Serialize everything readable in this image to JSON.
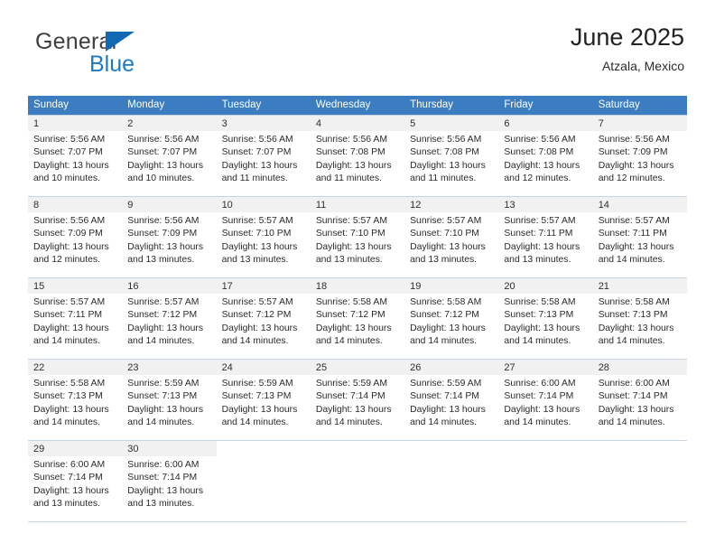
{
  "brand": {
    "name_top": "General",
    "name_bottom": "Blue",
    "triangle_icon": "blue-triangle-logo-icon",
    "color_top": "#3f3f3f",
    "color_bottom": "#1b7ac4"
  },
  "header": {
    "title": "June 2025",
    "subtitle": "Atzala, Mexico"
  },
  "theme": {
    "header_bg": "#3b7dc0",
    "header_text": "#ffffff",
    "daynum_band_bg": "#f1f1f1",
    "grid_line": "#c8d4e2",
    "body_text": "#2a2a2a"
  },
  "calendar": {
    "weekday_headers": [
      "Sunday",
      "Monday",
      "Tuesday",
      "Wednesday",
      "Thursday",
      "Friday",
      "Saturday"
    ],
    "weeks": [
      [
        {
          "day": "1",
          "lines": [
            "Sunrise: 5:56 AM",
            "Sunset: 7:07 PM",
            "Daylight: 13 hours",
            "and 10 minutes."
          ]
        },
        {
          "day": "2",
          "lines": [
            "Sunrise: 5:56 AM",
            "Sunset: 7:07 PM",
            "Daylight: 13 hours",
            "and 10 minutes."
          ]
        },
        {
          "day": "3",
          "lines": [
            "Sunrise: 5:56 AM",
            "Sunset: 7:07 PM",
            "Daylight: 13 hours",
            "and 11 minutes."
          ]
        },
        {
          "day": "4",
          "lines": [
            "Sunrise: 5:56 AM",
            "Sunset: 7:08 PM",
            "Daylight: 13 hours",
            "and 11 minutes."
          ]
        },
        {
          "day": "5",
          "lines": [
            "Sunrise: 5:56 AM",
            "Sunset: 7:08 PM",
            "Daylight: 13 hours",
            "and 11 minutes."
          ]
        },
        {
          "day": "6",
          "lines": [
            "Sunrise: 5:56 AM",
            "Sunset: 7:08 PM",
            "Daylight: 13 hours",
            "and 12 minutes."
          ]
        },
        {
          "day": "7",
          "lines": [
            "Sunrise: 5:56 AM",
            "Sunset: 7:09 PM",
            "Daylight: 13 hours",
            "and 12 minutes."
          ]
        }
      ],
      [
        {
          "day": "8",
          "lines": [
            "Sunrise: 5:56 AM",
            "Sunset: 7:09 PM",
            "Daylight: 13 hours",
            "and 12 minutes."
          ]
        },
        {
          "day": "9",
          "lines": [
            "Sunrise: 5:56 AM",
            "Sunset: 7:09 PM",
            "Daylight: 13 hours",
            "and 13 minutes."
          ]
        },
        {
          "day": "10",
          "lines": [
            "Sunrise: 5:57 AM",
            "Sunset: 7:10 PM",
            "Daylight: 13 hours",
            "and 13 minutes."
          ]
        },
        {
          "day": "11",
          "lines": [
            "Sunrise: 5:57 AM",
            "Sunset: 7:10 PM",
            "Daylight: 13 hours",
            "and 13 minutes."
          ]
        },
        {
          "day": "12",
          "lines": [
            "Sunrise: 5:57 AM",
            "Sunset: 7:10 PM",
            "Daylight: 13 hours",
            "and 13 minutes."
          ]
        },
        {
          "day": "13",
          "lines": [
            "Sunrise: 5:57 AM",
            "Sunset: 7:11 PM",
            "Daylight: 13 hours",
            "and 13 minutes."
          ]
        },
        {
          "day": "14",
          "lines": [
            "Sunrise: 5:57 AM",
            "Sunset: 7:11 PM",
            "Daylight: 13 hours",
            "and 14 minutes."
          ]
        }
      ],
      [
        {
          "day": "15",
          "lines": [
            "Sunrise: 5:57 AM",
            "Sunset: 7:11 PM",
            "Daylight: 13 hours",
            "and 14 minutes."
          ]
        },
        {
          "day": "16",
          "lines": [
            "Sunrise: 5:57 AM",
            "Sunset: 7:12 PM",
            "Daylight: 13 hours",
            "and 14 minutes."
          ]
        },
        {
          "day": "17",
          "lines": [
            "Sunrise: 5:57 AM",
            "Sunset: 7:12 PM",
            "Daylight: 13 hours",
            "and 14 minutes."
          ]
        },
        {
          "day": "18",
          "lines": [
            "Sunrise: 5:58 AM",
            "Sunset: 7:12 PM",
            "Daylight: 13 hours",
            "and 14 minutes."
          ]
        },
        {
          "day": "19",
          "lines": [
            "Sunrise: 5:58 AM",
            "Sunset: 7:12 PM",
            "Daylight: 13 hours",
            "and 14 minutes."
          ]
        },
        {
          "day": "20",
          "lines": [
            "Sunrise: 5:58 AM",
            "Sunset: 7:13 PM",
            "Daylight: 13 hours",
            "and 14 minutes."
          ]
        },
        {
          "day": "21",
          "lines": [
            "Sunrise: 5:58 AM",
            "Sunset: 7:13 PM",
            "Daylight: 13 hours",
            "and 14 minutes."
          ]
        }
      ],
      [
        {
          "day": "22",
          "lines": [
            "Sunrise: 5:58 AM",
            "Sunset: 7:13 PM",
            "Daylight: 13 hours",
            "and 14 minutes."
          ]
        },
        {
          "day": "23",
          "lines": [
            "Sunrise: 5:59 AM",
            "Sunset: 7:13 PM",
            "Daylight: 13 hours",
            "and 14 minutes."
          ]
        },
        {
          "day": "24",
          "lines": [
            "Sunrise: 5:59 AM",
            "Sunset: 7:13 PM",
            "Daylight: 13 hours",
            "and 14 minutes."
          ]
        },
        {
          "day": "25",
          "lines": [
            "Sunrise: 5:59 AM",
            "Sunset: 7:14 PM",
            "Daylight: 13 hours",
            "and 14 minutes."
          ]
        },
        {
          "day": "26",
          "lines": [
            "Sunrise: 5:59 AM",
            "Sunset: 7:14 PM",
            "Daylight: 13 hours",
            "and 14 minutes."
          ]
        },
        {
          "day": "27",
          "lines": [
            "Sunrise: 6:00 AM",
            "Sunset: 7:14 PM",
            "Daylight: 13 hours",
            "and 14 minutes."
          ]
        },
        {
          "day": "28",
          "lines": [
            "Sunrise: 6:00 AM",
            "Sunset: 7:14 PM",
            "Daylight: 13 hours",
            "and 14 minutes."
          ]
        }
      ],
      [
        {
          "day": "29",
          "lines": [
            "Sunrise: 6:00 AM",
            "Sunset: 7:14 PM",
            "Daylight: 13 hours",
            "and 13 minutes."
          ]
        },
        {
          "day": "30",
          "lines": [
            "Sunrise: 6:00 AM",
            "Sunset: 7:14 PM",
            "Daylight: 13 hours",
            "and 13 minutes."
          ]
        },
        {
          "day": "",
          "lines": []
        },
        {
          "day": "",
          "lines": []
        },
        {
          "day": "",
          "lines": []
        },
        {
          "day": "",
          "lines": []
        },
        {
          "day": "",
          "lines": []
        }
      ]
    ]
  }
}
